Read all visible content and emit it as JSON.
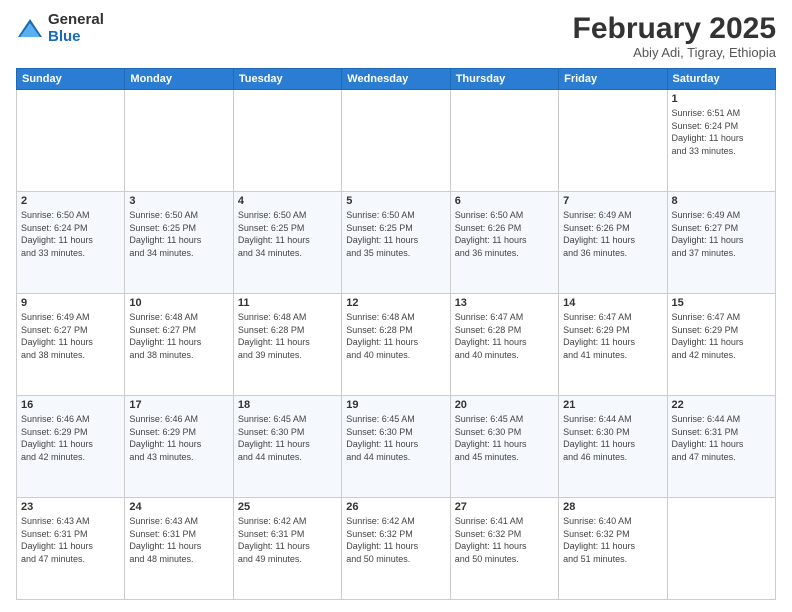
{
  "logo": {
    "general": "General",
    "blue": "Blue"
  },
  "header": {
    "month": "February 2025",
    "location": "Abiy Adi, Tigray, Ethiopia"
  },
  "weekdays": [
    "Sunday",
    "Monday",
    "Tuesday",
    "Wednesday",
    "Thursday",
    "Friday",
    "Saturday"
  ],
  "weeks": [
    [
      {
        "day": "",
        "info": ""
      },
      {
        "day": "",
        "info": ""
      },
      {
        "day": "",
        "info": ""
      },
      {
        "day": "",
        "info": ""
      },
      {
        "day": "",
        "info": ""
      },
      {
        "day": "",
        "info": ""
      },
      {
        "day": "1",
        "info": "Sunrise: 6:51 AM\nSunset: 6:24 PM\nDaylight: 11 hours\nand 33 minutes."
      }
    ],
    [
      {
        "day": "2",
        "info": "Sunrise: 6:50 AM\nSunset: 6:24 PM\nDaylight: 11 hours\nand 33 minutes."
      },
      {
        "day": "3",
        "info": "Sunrise: 6:50 AM\nSunset: 6:25 PM\nDaylight: 11 hours\nand 34 minutes."
      },
      {
        "day": "4",
        "info": "Sunrise: 6:50 AM\nSunset: 6:25 PM\nDaylight: 11 hours\nand 34 minutes."
      },
      {
        "day": "5",
        "info": "Sunrise: 6:50 AM\nSunset: 6:25 PM\nDaylight: 11 hours\nand 35 minutes."
      },
      {
        "day": "6",
        "info": "Sunrise: 6:50 AM\nSunset: 6:26 PM\nDaylight: 11 hours\nand 36 minutes."
      },
      {
        "day": "7",
        "info": "Sunrise: 6:49 AM\nSunset: 6:26 PM\nDaylight: 11 hours\nand 36 minutes."
      },
      {
        "day": "8",
        "info": "Sunrise: 6:49 AM\nSunset: 6:27 PM\nDaylight: 11 hours\nand 37 minutes."
      }
    ],
    [
      {
        "day": "9",
        "info": "Sunrise: 6:49 AM\nSunset: 6:27 PM\nDaylight: 11 hours\nand 38 minutes."
      },
      {
        "day": "10",
        "info": "Sunrise: 6:48 AM\nSunset: 6:27 PM\nDaylight: 11 hours\nand 38 minutes."
      },
      {
        "day": "11",
        "info": "Sunrise: 6:48 AM\nSunset: 6:28 PM\nDaylight: 11 hours\nand 39 minutes."
      },
      {
        "day": "12",
        "info": "Sunrise: 6:48 AM\nSunset: 6:28 PM\nDaylight: 11 hours\nand 40 minutes."
      },
      {
        "day": "13",
        "info": "Sunrise: 6:47 AM\nSunset: 6:28 PM\nDaylight: 11 hours\nand 40 minutes."
      },
      {
        "day": "14",
        "info": "Sunrise: 6:47 AM\nSunset: 6:29 PM\nDaylight: 11 hours\nand 41 minutes."
      },
      {
        "day": "15",
        "info": "Sunrise: 6:47 AM\nSunset: 6:29 PM\nDaylight: 11 hours\nand 42 minutes."
      }
    ],
    [
      {
        "day": "16",
        "info": "Sunrise: 6:46 AM\nSunset: 6:29 PM\nDaylight: 11 hours\nand 42 minutes."
      },
      {
        "day": "17",
        "info": "Sunrise: 6:46 AM\nSunset: 6:29 PM\nDaylight: 11 hours\nand 43 minutes."
      },
      {
        "day": "18",
        "info": "Sunrise: 6:45 AM\nSunset: 6:30 PM\nDaylight: 11 hours\nand 44 minutes."
      },
      {
        "day": "19",
        "info": "Sunrise: 6:45 AM\nSunset: 6:30 PM\nDaylight: 11 hours\nand 44 minutes."
      },
      {
        "day": "20",
        "info": "Sunrise: 6:45 AM\nSunset: 6:30 PM\nDaylight: 11 hours\nand 45 minutes."
      },
      {
        "day": "21",
        "info": "Sunrise: 6:44 AM\nSunset: 6:30 PM\nDaylight: 11 hours\nand 46 minutes."
      },
      {
        "day": "22",
        "info": "Sunrise: 6:44 AM\nSunset: 6:31 PM\nDaylight: 11 hours\nand 47 minutes."
      }
    ],
    [
      {
        "day": "23",
        "info": "Sunrise: 6:43 AM\nSunset: 6:31 PM\nDaylight: 11 hours\nand 47 minutes."
      },
      {
        "day": "24",
        "info": "Sunrise: 6:43 AM\nSunset: 6:31 PM\nDaylight: 11 hours\nand 48 minutes."
      },
      {
        "day": "25",
        "info": "Sunrise: 6:42 AM\nSunset: 6:31 PM\nDaylight: 11 hours\nand 49 minutes."
      },
      {
        "day": "26",
        "info": "Sunrise: 6:42 AM\nSunset: 6:32 PM\nDaylight: 11 hours\nand 50 minutes."
      },
      {
        "day": "27",
        "info": "Sunrise: 6:41 AM\nSunset: 6:32 PM\nDaylight: 11 hours\nand 50 minutes."
      },
      {
        "day": "28",
        "info": "Sunrise: 6:40 AM\nSunset: 6:32 PM\nDaylight: 11 hours\nand 51 minutes."
      },
      {
        "day": "",
        "info": ""
      }
    ]
  ]
}
